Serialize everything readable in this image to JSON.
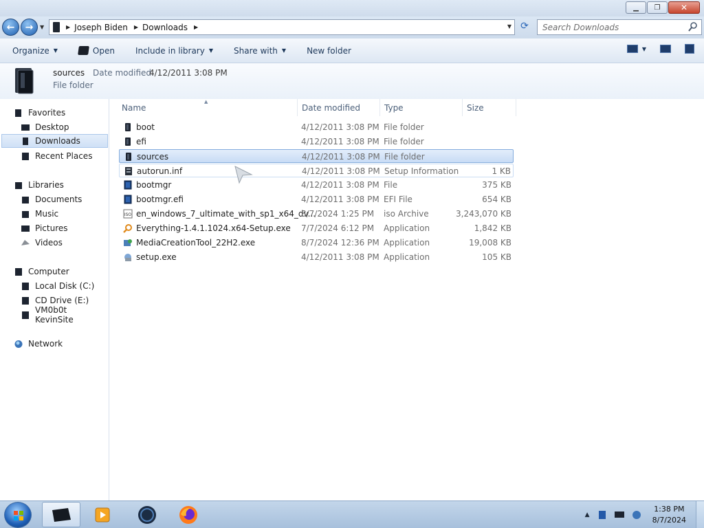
{
  "window": {
    "minimize_label": "Minimize",
    "maximize_label": "Maximize",
    "close_label": "Close"
  },
  "address": {
    "crumbs": [
      "Joseph Biden",
      "Downloads"
    ],
    "search_placeholder": "Search Downloads"
  },
  "toolbar": {
    "organize": "Organize",
    "open": "Open",
    "include_in_library": "Include in library",
    "share_with": "Share with",
    "new_folder": "New folder"
  },
  "details": {
    "name": "sources",
    "date_modified_label": "Date modified:",
    "date_modified_value": "4/12/2011 3:08 PM",
    "type": "File folder"
  },
  "nav": {
    "favorites": "Favorites",
    "desktop": "Desktop",
    "downloads": "Downloads",
    "recent_places": "Recent Places",
    "libraries": "Libraries",
    "documents": "Documents",
    "music": "Music",
    "pictures": "Pictures",
    "videos": "Videos",
    "computer": "Computer",
    "local_disk": "Local Disk (C:)",
    "cd_drive": "CD Drive (E:)",
    "vm_share": "VM0b0t KevinSite",
    "network": "Network"
  },
  "columns": {
    "name": "Name",
    "date_modified": "Date modified",
    "type": "Type",
    "size": "Size"
  },
  "files": [
    {
      "name": "boot",
      "date": "4/12/2011 3:08 PM",
      "type": "File folder",
      "size": "",
      "icon": "folder-icon"
    },
    {
      "name": "efi",
      "date": "4/12/2011 3:08 PM",
      "type": "File folder",
      "size": "",
      "icon": "folder-icon"
    },
    {
      "name": "sources",
      "date": "4/12/2011 3:08 PM",
      "type": "File folder",
      "size": "",
      "icon": "folder-icon"
    },
    {
      "name": "autorun.inf",
      "date": "4/12/2011 3:08 PM",
      "type": "Setup Information",
      "size": "1 KB",
      "icon": "setup-info-icon"
    },
    {
      "name": "bootmgr",
      "date": "4/12/2011 3:08 PM",
      "type": "File",
      "size": "375 KB",
      "icon": "file-icon"
    },
    {
      "name": "bootmgr.efi",
      "date": "4/12/2011 3:08 PM",
      "type": "EFI File",
      "size": "654 KB",
      "icon": "file-icon"
    },
    {
      "name": "en_windows_7_ultimate_with_sp1_x64_dv...",
      "date": "8/7/2024 1:25 PM",
      "type": "iso Archive",
      "size": "3,243,070 KB",
      "icon": "iso-icon"
    },
    {
      "name": "Everything-1.4.1.1024.x64-Setup.exe",
      "date": "7/7/2024 6:12 PM",
      "type": "Application",
      "size": "1,842 KB",
      "icon": "magnifier-app-icon"
    },
    {
      "name": "MediaCreationTool_22H2.exe",
      "date": "8/7/2024 12:36 PM",
      "type": "Application",
      "size": "19,008 KB",
      "icon": "media-creation-icon"
    },
    {
      "name": "setup.exe",
      "date": "4/12/2011 3:08 PM",
      "type": "Application",
      "size": "105 KB",
      "icon": "setup-app-icon"
    }
  ],
  "selected_row": 2,
  "taskbar": {
    "time": "1:38 PM",
    "date": "8/7/2024"
  },
  "colors": {
    "selection": "#cfe0f6",
    "accent": "#1e395b"
  }
}
